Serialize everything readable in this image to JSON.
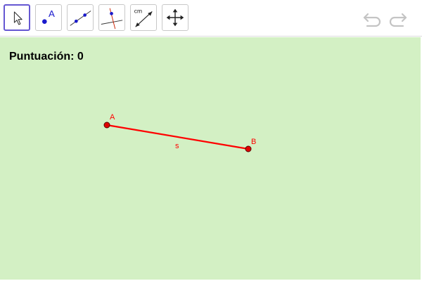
{
  "toolbar": {
    "tools": [
      {
        "name": "move-tool",
        "icon": "arrow-pointer-icon",
        "selected": true
      },
      {
        "name": "point-tool",
        "icon": "point-icon",
        "label": "A"
      },
      {
        "name": "line-tool",
        "icon": "line-through-two-points-icon"
      },
      {
        "name": "perpendicular-line-tool",
        "icon": "perpendicular-line-icon"
      },
      {
        "name": "distance-tool",
        "icon": "distance-measure-icon",
        "label": "cm"
      },
      {
        "name": "move-view-tool",
        "icon": "move-graphics-view-icon"
      }
    ],
    "undo_icon": "undo-icon",
    "redo_icon": "redo-icon"
  },
  "score": {
    "label": "Puntuación:",
    "value": "0"
  },
  "construction": {
    "point_a": "A",
    "point_b": "B",
    "segment": "s"
  },
  "colors": {
    "canvas_bg": "#d3f0c4",
    "segment": "#ff0000",
    "point_fill": "#e00000",
    "selected_tool_border": "#6557d2",
    "tool_icon_blue": "#1a1acc"
  }
}
